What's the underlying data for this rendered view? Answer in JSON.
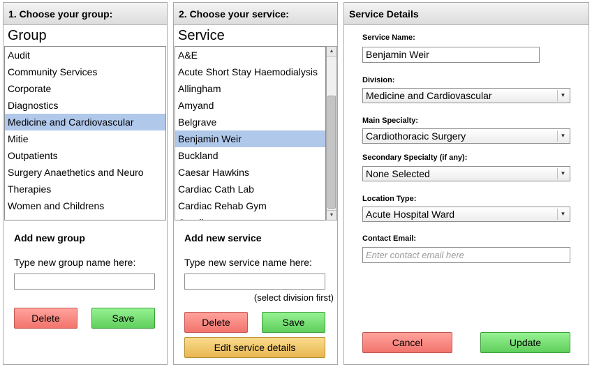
{
  "group_panel": {
    "header": "1. Choose your group:",
    "list_title": "Group",
    "items": [
      "Audit",
      "Community Services",
      "Corporate",
      "Diagnostics",
      "Medicine and Cardiovascular",
      "Mitie",
      "Outpatients",
      "Surgery Anaethetics and Neuro",
      "Therapies",
      "Women and Childrens"
    ],
    "selected": "Medicine and Cardiovascular",
    "add_title": "Add new group",
    "input_label": "Type new group name here:",
    "input_value": "",
    "delete_label": "Delete",
    "save_label": "Save"
  },
  "service_panel": {
    "header": "2. Choose your service:",
    "list_title": "Service",
    "items": [
      "A&E",
      "Acute Short Stay Haemodialysis",
      "Allingham",
      "Amyand",
      "Belgrave",
      "Benjamin Weir",
      "Buckland",
      "Caesar Hawkins",
      "Cardiac Cath Lab",
      "Cardiac Rehab Gym",
      "Caroline"
    ],
    "selected": "Benjamin Weir",
    "add_title": "Add new service",
    "input_label": "Type new service name here:",
    "input_value": "",
    "hint": "(select division first)",
    "delete_label": "Delete",
    "save_label": "Save",
    "edit_label": "Edit service details"
  },
  "details_panel": {
    "header": "Service Details",
    "service_name_label": "Service Name:",
    "service_name_value": "Benjamin Weir",
    "division_label": "Division:",
    "division_value": "Medicine and Cardiovascular",
    "main_specialty_label": "Main Specialty:",
    "main_specialty_value": "Cardiothoracic Surgery",
    "secondary_specialty_label": "Secondary Specialty (if any):",
    "secondary_specialty_value": "None Selected",
    "location_type_label": "Location Type:",
    "location_type_value": "Acute Hospital Ward",
    "contact_email_label": "Contact Email:",
    "contact_email_placeholder": "Enter contact email here",
    "cancel_label": "Cancel",
    "update_label": "Update"
  },
  "icons": {
    "dropdown": "chevron-down-icon",
    "scroll_up": "scroll-up-arrow-icon",
    "scroll_down": "scroll-down-arrow-icon"
  },
  "colors": {
    "selected_row": "#b0c8ea",
    "delete_button": "#f2746d",
    "save_button": "#5fcf5c",
    "edit_button": "#e8b650"
  }
}
